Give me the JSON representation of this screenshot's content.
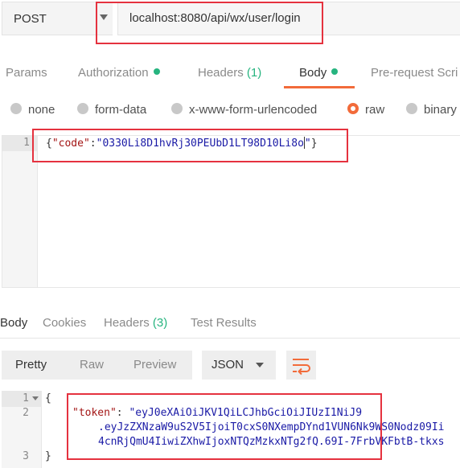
{
  "request": {
    "method": "POST",
    "url": "localhost:8080/api/wx/user/login"
  },
  "request_tabs": [
    {
      "label": "Params"
    },
    {
      "label": "Authorization",
      "indicator": "green-dot"
    },
    {
      "label": "Headers",
      "count": "(1)"
    },
    {
      "label": "Body",
      "indicator": "green-dot",
      "active": true
    },
    {
      "label": "Pre-request Scri"
    }
  ],
  "body_types": [
    {
      "label": "none"
    },
    {
      "label": "form-data"
    },
    {
      "label": "x-www-form-urlencoded"
    },
    {
      "label": "raw",
      "selected": true
    },
    {
      "label": "binary"
    }
  ],
  "request_editor": {
    "line_numbers": [
      "1"
    ],
    "code": {
      "open": "{",
      "key": "\"code\"",
      "colon": ":",
      "value_head": "\"0330Li8D1hvRj30PEUbD1LT98D10Li8o",
      "value_tail": "\"",
      "close": "}"
    }
  },
  "response_tabs": [
    {
      "label": "Body",
      "active": true
    },
    {
      "label": "Cookies"
    },
    {
      "label": "Headers",
      "count": "(3)"
    },
    {
      "label": "Test Results"
    }
  ],
  "response_toolbar": {
    "view_modes": [
      "Pretty",
      "Raw",
      "Preview"
    ],
    "active_view": "Pretty",
    "format": "JSON",
    "wrap_icon": "wrap-lines-icon"
  },
  "response_editor": {
    "line_numbers": [
      "1",
      "2",
      "3"
    ],
    "open": "{",
    "token_key": "\"token\"",
    "colon": ": ",
    "token_line1": "\"eyJ0eXAiOiJKV1QiLCJhbGciOiJIUzI1NiJ9",
    "token_line2": ".eyJzZXNzaW9uS2V5IjoiT0cxS0NXempDYnd1VUN6Nk9WS0Nodz09Ii",
    "token_line3": "4cnRjQmU4IiwiZXhwIjoxNTQzMzkxNTg2fQ.69I-7FrbVKFbtB-tkxs",
    "close": "}"
  },
  "colors": {
    "accent": "#f26b3a",
    "status_green": "#26b47f",
    "highlight_box": "#e5323f",
    "json_key": "#a31515",
    "json_string": "#1a1aa6"
  }
}
